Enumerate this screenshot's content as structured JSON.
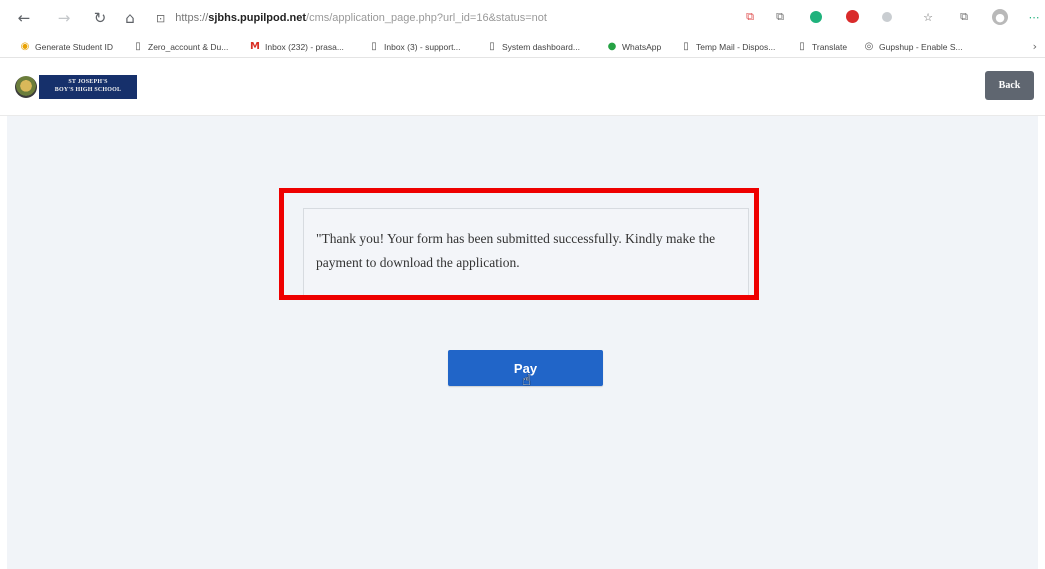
{
  "browser": {
    "url": {
      "protocol": "https://",
      "host": "sjbhs.pupilpod.net",
      "path": "/cms/application_page.php?url_id=16&status=not"
    },
    "nav_icons": [
      "back-arrow-icon",
      "forward-arrow-icon",
      "reload-icon",
      "home-icon"
    ],
    "extension_icons": [
      "translate-icon",
      "translate-alt-icon",
      "green-dot-icon",
      "red-stop-icon",
      "grey-dot-icon",
      "star-icon",
      "collections-icon",
      "profile-icon"
    ]
  },
  "bookmarks": [
    {
      "label": "Generate Student ID"
    },
    {
      "label": "Zero_account & Du..."
    },
    {
      "label": "Inbox (232) - prasa..."
    },
    {
      "label": "Inbox (3) - support..."
    },
    {
      "label": "System dashboard..."
    },
    {
      "label": "WhatsApp"
    },
    {
      "label": "Temp Mail - Dispos..."
    },
    {
      "label": "Translate"
    },
    {
      "label": "Gupshup - Enable S..."
    }
  ],
  "header": {
    "school_name_line1": "ST JOSEPH'S",
    "school_name_line2": "BOY'S HIGH SCHOOL",
    "back_label": "Back"
  },
  "main": {
    "message": "\"Thank you! Your form has been submitted successfully. Kindly make the payment to download the application.",
    "pay_label": "Pay"
  },
  "colors": {
    "highlight": "#ee0000",
    "pay_button": "#2165c8",
    "back_button": "#5f6670",
    "school_banner": "#16306b",
    "page_bg": "#f1f4f8"
  }
}
